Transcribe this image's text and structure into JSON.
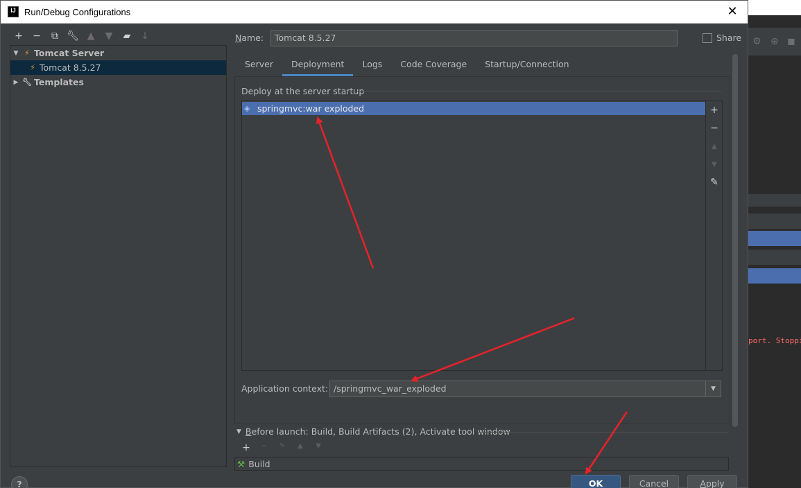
{
  "dialog": {
    "title": "Run/Debug Configurations",
    "app_icon_label": "IJ",
    "close_glyph": "✕"
  },
  "left_toolbar": {
    "icons": [
      "add-icon",
      "remove-icon",
      "copy-icon",
      "wrench-icon",
      "move-up-icon",
      "move-down-icon",
      "new-folder-icon",
      "sort-icon"
    ]
  },
  "tree": {
    "items": [
      {
        "label": "Tomcat Server",
        "expanded": true,
        "icon": "tomcat-icon"
      },
      {
        "label": "Tomcat 8.5.27",
        "selected": true,
        "icon": "tomcat-icon"
      },
      {
        "label": "Templates",
        "expanded": false,
        "icon": "wrench-icon"
      }
    ]
  },
  "name": {
    "label_prefix": "N",
    "label_rest": "ame:",
    "value": "Tomcat 8.5.27"
  },
  "share": {
    "label": "Share",
    "checked": false
  },
  "tabs": [
    {
      "label": "Server"
    },
    {
      "label": "Deployment",
      "active": true
    },
    {
      "label": "Logs"
    },
    {
      "label": "Code Coverage"
    },
    {
      "label": "Startup/Connection"
    }
  ],
  "deployment": {
    "group_label": "Deploy at the server startup",
    "items": [
      {
        "label": "springmvc:war exploded",
        "icon": "artifact-icon"
      }
    ],
    "side_buttons": [
      "add-icon",
      "remove-icon",
      "move-up-icon",
      "move-down-icon",
      "edit-icon"
    ],
    "context_label": "Application context:",
    "context_value": "/springmvc_war_exploded"
  },
  "before_launch": {
    "prefix": "B",
    "label": "efore launch: Build, Build Artifacts (2), Activate tool window",
    "item": "Build"
  },
  "buttons": {
    "help": "?",
    "ok": "OK",
    "cancel": "Cancel",
    "apply_prefix": "A",
    "apply_rest": "pply"
  },
  "background_ide": {
    "log_text": "port. Stoppin"
  },
  "colors": {
    "accent": "#4a88c7",
    "selection": "#4b6eaf",
    "annotation_arrow": "#e8222a"
  }
}
